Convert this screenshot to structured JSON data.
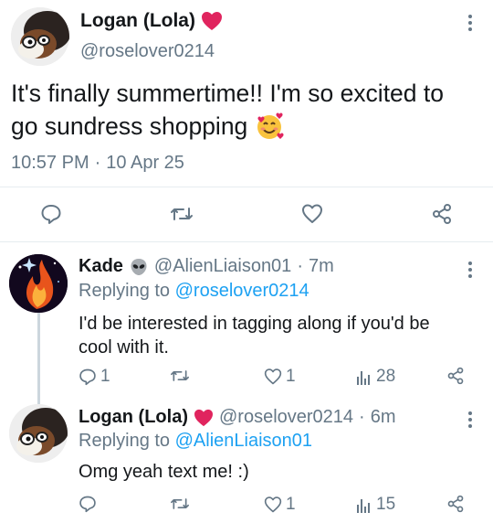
{
  "colors": {
    "accent": "#1da1f2",
    "icon_gray": "#657786",
    "heart_red": "#e0245e"
  },
  "main_tweet": {
    "display_name": "Logan (Lola)",
    "name_emoji": "heart-emoji",
    "handle": "@roselover0214",
    "text_line1": "It's finally summertime!! I'm so excited to",
    "text_line2": "go sundress shopping",
    "text_emoji": "smiling-face-with-hearts-emoji",
    "time": "10:57 PM",
    "separator": "·",
    "date": "10 Apr 25",
    "actions": [
      "reply-icon",
      "retweet-icon",
      "like-icon",
      "share-icon"
    ]
  },
  "replies": [
    {
      "display_name": "Kade",
      "name_emoji": "alien-emoji",
      "handle": "@AlienLiaison01",
      "separator": "·",
      "time_ago": "7m",
      "replying_prefix": "Replying to",
      "replying_to": "@roselover0214",
      "text_line1": "I'd be interested in tagging along if you'd be",
      "text_line2": "cool with it.",
      "reply_count": "1",
      "retweet_count": "",
      "like_count": "1",
      "view_count": "28"
    },
    {
      "display_name": "Logan (Lola)",
      "name_emoji": "heart-emoji",
      "handle": "@roselover0214",
      "separator": "·",
      "time_ago": "6m",
      "replying_prefix": "Replying to",
      "replying_to": "@AlienLiaison01",
      "text_line1": "Omg yeah text me! :)",
      "reply_count": "",
      "retweet_count": "",
      "like_count": "1",
      "view_count": "15"
    }
  ]
}
